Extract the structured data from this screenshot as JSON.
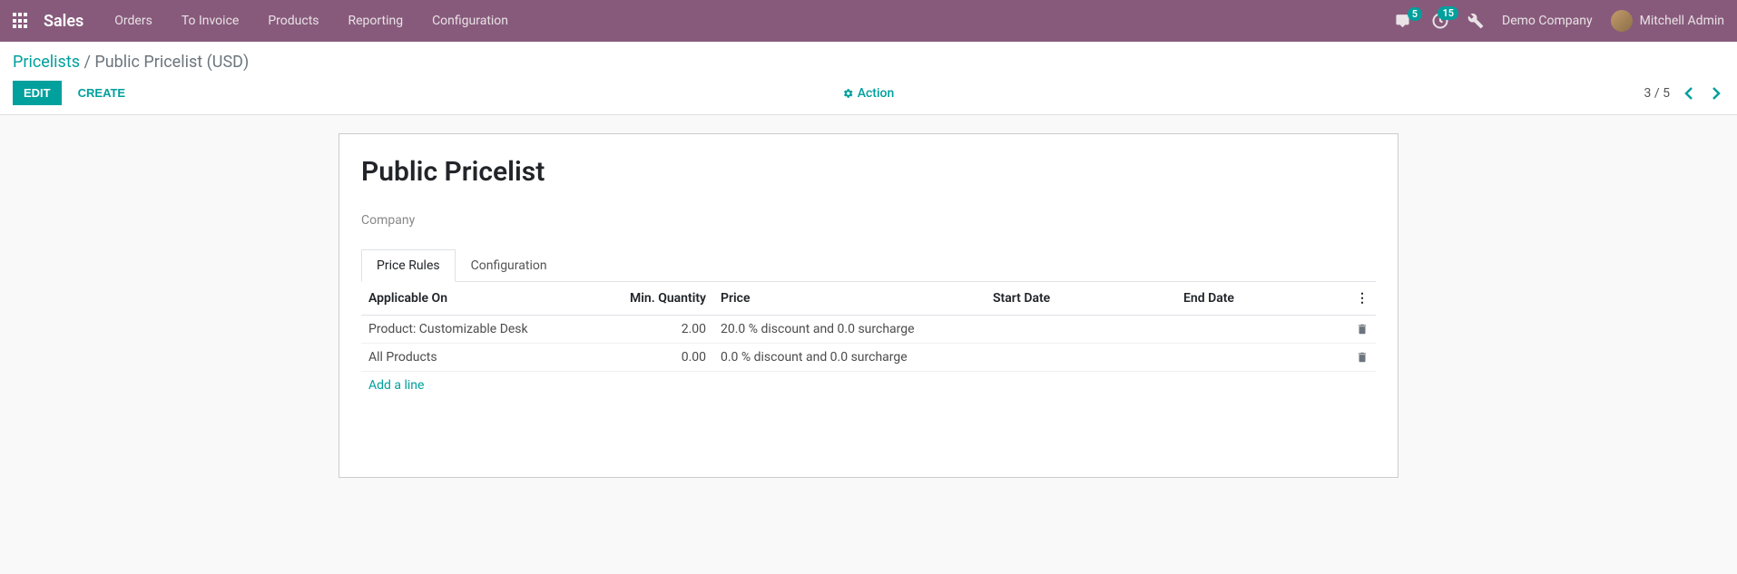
{
  "navbar": {
    "app_name": "Sales",
    "menus": [
      "Orders",
      "To Invoice",
      "Products",
      "Reporting",
      "Configuration"
    ],
    "messages_badge": "5",
    "activities_badge": "15",
    "company": "Demo Company",
    "user_name": "Mitchell Admin"
  },
  "breadcrumbs": {
    "parent": "Pricelists",
    "sep": " / ",
    "current": "Public Pricelist (USD)"
  },
  "buttons": {
    "edit": "Edit",
    "create": "Create",
    "action": "Action"
  },
  "pager": {
    "current": "3",
    "sep": " / ",
    "total": "5"
  },
  "record": {
    "title": "Public Pricelist",
    "company_label": "Company"
  },
  "tabs": {
    "price_rules": "Price Rules",
    "configuration": "Configuration"
  },
  "table": {
    "headers": {
      "applicable_on": "Applicable On",
      "min_qty": "Min. Quantity",
      "price": "Price",
      "start_date": "Start Date",
      "end_date": "End Date"
    },
    "rows": [
      {
        "applicable_on": "Product: Customizable Desk",
        "min_qty": "2.00",
        "price": "20.0 % discount and 0.0 surcharge",
        "start_date": "",
        "end_date": ""
      },
      {
        "applicable_on": "All Products",
        "min_qty": "0.00",
        "price": "0.0 % discount and 0.0 surcharge",
        "start_date": "",
        "end_date": ""
      }
    ],
    "add_line": "Add a line"
  }
}
